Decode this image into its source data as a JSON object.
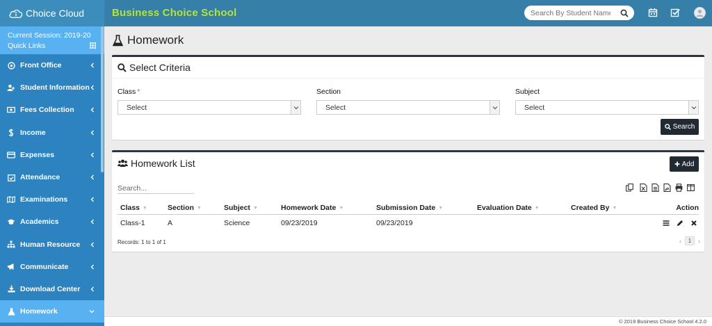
{
  "app": {
    "logo_text": "Choice Cloud",
    "school_name": "Business Choice School"
  },
  "header": {
    "search_placeholder": "Search By Student Name"
  },
  "sidebar": {
    "session": "Current Session: 2019-20",
    "quick_links": "Quick Links",
    "items": [
      {
        "label": "Front Office",
        "icon": "front-office-icon"
      },
      {
        "label": "Student Information",
        "icon": "user-plus-icon"
      },
      {
        "label": "Fees Collection",
        "icon": "money-icon"
      },
      {
        "label": "Income",
        "icon": "dollar-icon"
      },
      {
        "label": "Expenses",
        "icon": "credit-card-icon"
      },
      {
        "label": "Attendance",
        "icon": "calendar-check-icon"
      },
      {
        "label": "Examinations",
        "icon": "map-icon"
      },
      {
        "label": "Academics",
        "icon": "graduation-cap-icon"
      },
      {
        "label": "Human Resource",
        "icon": "sitemap-icon"
      },
      {
        "label": "Communicate",
        "icon": "bullhorn-icon"
      },
      {
        "label": "Download Center",
        "icon": "download-icon"
      },
      {
        "label": "Homework",
        "icon": "flask-icon",
        "active": true
      }
    ]
  },
  "page": {
    "title": "Homework"
  },
  "criteria": {
    "title": "Select Criteria",
    "class_label": "Class",
    "required_mark": "*",
    "section_label": "Section",
    "subject_label": "Subject",
    "class_value": "Select",
    "section_value": "Select",
    "subject_value": "Select",
    "search_button": "Search"
  },
  "homework_list": {
    "title": "Homework List",
    "add_button": "Add",
    "search_placeholder": "Search...",
    "columns": [
      "Class",
      "Section",
      "Subject",
      "Homework Date",
      "Submission Date",
      "Evaluation Date",
      "Created By",
      "Action"
    ],
    "rows": [
      {
        "class": "Class-1",
        "section": "A",
        "subject": "Science",
        "homework_date": "09/23/2019",
        "submission_date": "09/23/2019",
        "evaluation_date": "",
        "created_by": ""
      }
    ],
    "records": "Records: 1 to 1 of 1",
    "page": "1"
  },
  "footer": {
    "text": "© 2019 Business Choice School 4.2.0"
  },
  "colors": {
    "topbar": "#367fa9",
    "sidebar": "#2c83c0",
    "active": "#58b2f2",
    "brand_text": "#b4e534",
    "button": "#212a33"
  }
}
